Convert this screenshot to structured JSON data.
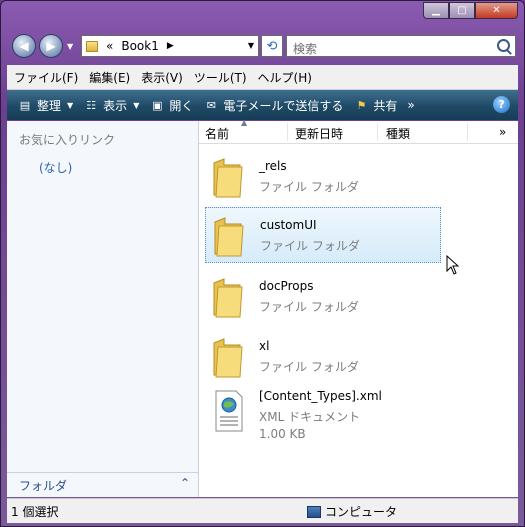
{
  "address": {
    "crumb_prefix": "«",
    "crumb": "Book1"
  },
  "search": {
    "placeholder": "検索"
  },
  "menu": [
    "ファイル(F)",
    "編集(E)",
    "表示(V)",
    "ツール(T)",
    "ヘルプ(H)"
  ],
  "toolbar": {
    "organize": "整理",
    "views": "表示",
    "open": "開く",
    "email": "電子メールで送信する",
    "share": "共有",
    "more": "»"
  },
  "navpane": {
    "header": "お気に入りリンク",
    "none": "(なし)",
    "folders": "フォルダ"
  },
  "columns": {
    "name": "名前",
    "modified": "更新日時",
    "type": "種類",
    "more": "»"
  },
  "items": [
    {
      "name": "_rels",
      "type": "ファイル フォルダ"
    },
    {
      "name": "customUI",
      "type": "ファイル フォルダ"
    },
    {
      "name": "docProps",
      "type": "ファイル フォルダ"
    },
    {
      "name": "xl",
      "type": "ファイル フォルダ"
    },
    {
      "name": "[Content_Types].xml",
      "type": "XML ドキュメント",
      "size": "1.00 KB"
    }
  ],
  "status": {
    "selection": "1 個選択",
    "location": "コンピュータ"
  },
  "colors": {
    "toolbar": "#1f4a66",
    "link": "#2b63b6",
    "selection": "#d6ebfa"
  }
}
